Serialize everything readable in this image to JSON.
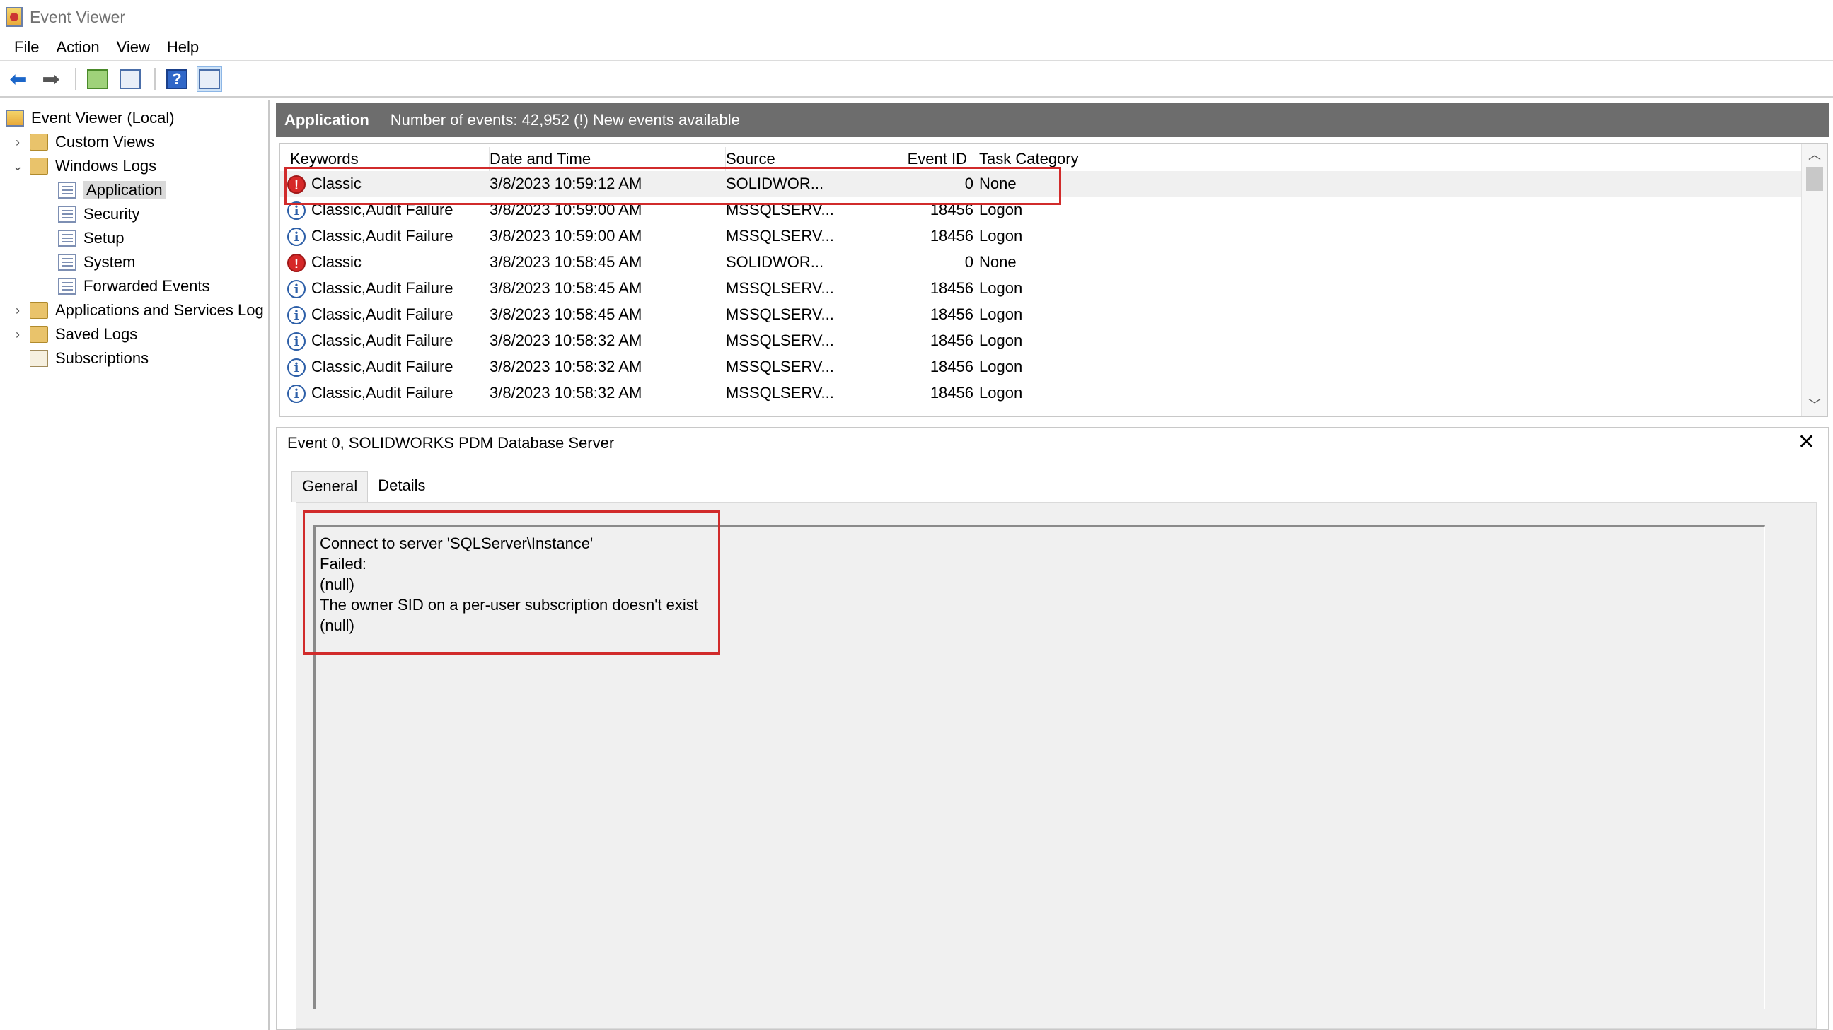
{
  "window": {
    "title": "Event Viewer"
  },
  "menu": [
    "File",
    "Action",
    "View",
    "Help"
  ],
  "toolbar": {
    "icons": [
      "back-arrow-icon",
      "forward-arrow-icon",
      "up-folder-icon",
      "show-hide-console-tree-icon",
      "help-icon",
      "show-hide-action-pane-icon"
    ]
  },
  "tree": {
    "root": "Event Viewer (Local)",
    "custom_views": "Custom Views",
    "windows_logs": "Windows Logs",
    "logs": [
      "Application",
      "Security",
      "Setup",
      "System",
      "Forwarded Events"
    ],
    "apps_services": "Applications and Services Log",
    "saved_logs": "Saved Logs",
    "subscriptions": "Subscriptions"
  },
  "log_header": {
    "name": "Application",
    "summary": "Number of events: 42,952 (!) New events available"
  },
  "columns": {
    "keywords": "Keywords",
    "date_time": "Date and Time",
    "source": "Source",
    "event_id": "Event ID",
    "task_category": "Task Category"
  },
  "events": [
    {
      "level": "error",
      "keywords": "Classic",
      "date_time": "3/8/2023 10:59:12 AM",
      "source": "SOLIDWOR...",
      "event_id": "0",
      "task": "None"
    },
    {
      "level": "info",
      "keywords": "Classic,Audit Failure",
      "date_time": "3/8/2023 10:59:00 AM",
      "source": "MSSQLSERV...",
      "event_id": "18456",
      "task": "Logon"
    },
    {
      "level": "info",
      "keywords": "Classic,Audit Failure",
      "date_time": "3/8/2023 10:59:00 AM",
      "source": "MSSQLSERV...",
      "event_id": "18456",
      "task": "Logon"
    },
    {
      "level": "error",
      "keywords": "Classic",
      "date_time": "3/8/2023 10:58:45 AM",
      "source": "SOLIDWOR...",
      "event_id": "0",
      "task": "None"
    },
    {
      "level": "info",
      "keywords": "Classic,Audit Failure",
      "date_time": "3/8/2023 10:58:45 AM",
      "source": "MSSQLSERV...",
      "event_id": "18456",
      "task": "Logon"
    },
    {
      "level": "info",
      "keywords": "Classic,Audit Failure",
      "date_time": "3/8/2023 10:58:45 AM",
      "source": "MSSQLSERV...",
      "event_id": "18456",
      "task": "Logon"
    },
    {
      "level": "info",
      "keywords": "Classic,Audit Failure",
      "date_time": "3/8/2023 10:58:32 AM",
      "source": "MSSQLSERV...",
      "event_id": "18456",
      "task": "Logon"
    },
    {
      "level": "info",
      "keywords": "Classic,Audit Failure",
      "date_time": "3/8/2023 10:58:32 AM",
      "source": "MSSQLSERV...",
      "event_id": "18456",
      "task": "Logon"
    },
    {
      "level": "info",
      "keywords": "Classic,Audit Failure",
      "date_time": "3/8/2023 10:58:32 AM",
      "source": "MSSQLSERV...",
      "event_id": "18456",
      "task": "Logon"
    }
  ],
  "detail": {
    "title": "Event 0, SOLIDWORKS PDM Database Server",
    "close": "✕",
    "tabs": [
      "General",
      "Details"
    ],
    "message_lines": [
      "Connect to server 'SQLServer\\Instance'",
      "Failed:",
      "(null)",
      "The owner SID on a per-user subscription doesn't exist",
      "(null)"
    ]
  },
  "colors": {
    "highlight": "#d12b2b",
    "header_bar": "#6d6d6d",
    "error": "#d62828",
    "info": "#2d5fa8"
  }
}
